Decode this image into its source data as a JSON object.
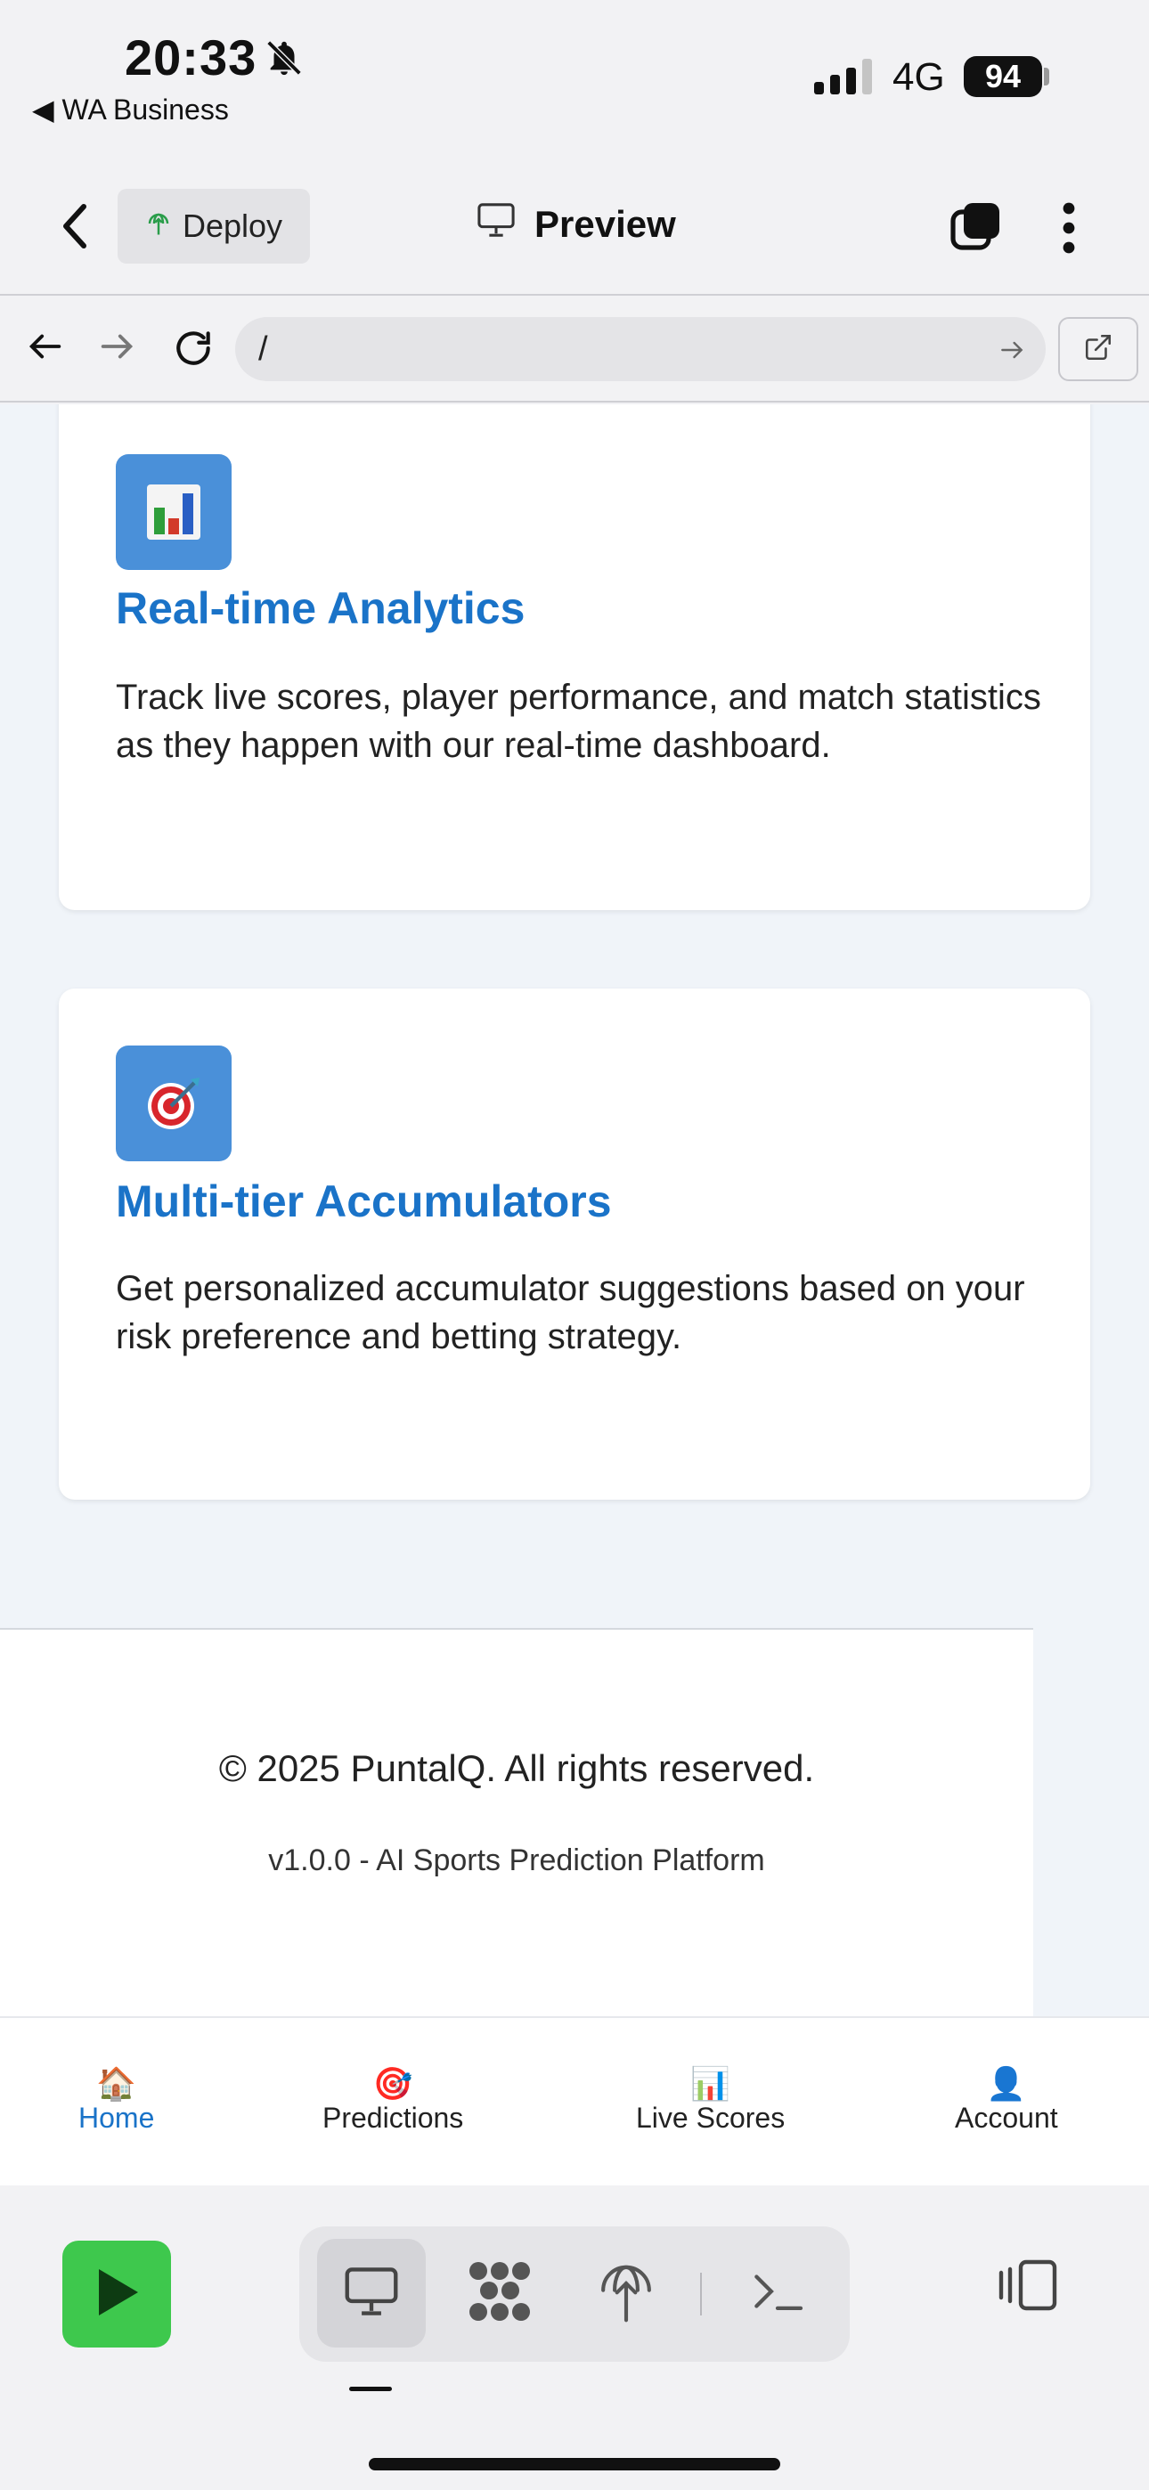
{
  "status_bar": {
    "time": "20:33",
    "back_app": "◀ WA Business",
    "network": "4G",
    "battery": "94"
  },
  "header": {
    "deploy_label": "Deploy",
    "preview_label": "Preview"
  },
  "browser": {
    "url": "/"
  },
  "features": [
    {
      "icon": "📊",
      "title": "Real-time Analytics",
      "description": "Track live scores, player performance, and match statistics as they happen with our real-time dashboard."
    },
    {
      "icon": "🎯",
      "title": "Multi-tier Accumulators",
      "description": "Get personalized accumulator suggestions based on your risk preference and betting strategy."
    }
  ],
  "footer": {
    "copyright": "© 2025 PuntalQ. All rights reserved.",
    "version": "v1.0.0 - AI Sports Prediction Platform"
  },
  "tabbar": {
    "items": [
      {
        "emoji": "🏠",
        "label": "Home",
        "active": true
      },
      {
        "emoji": "🎯",
        "label": "Predictions",
        "active": false
      },
      {
        "emoji": "📊",
        "label": "Live Scores",
        "active": false
      },
      {
        "emoji": "👤",
        "label": "Account",
        "active": false
      }
    ]
  },
  "colors": {
    "accent": "#1a73c8",
    "feature_icon_bg": "#4a90d9",
    "run_button": "#3ec84d",
    "content_bg": "#f0f4f9"
  }
}
